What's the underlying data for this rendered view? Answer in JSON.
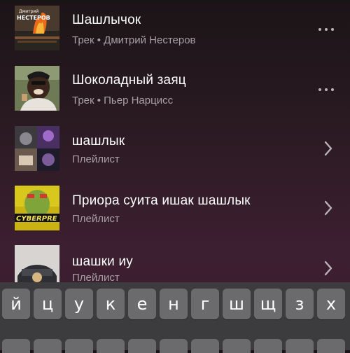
{
  "results": [
    {
      "title": "Шашлычок",
      "subtitle": "Трек • Дмитрий Нестеров",
      "action": "more-options",
      "thumb": "track-cover-1"
    },
    {
      "title": "Шоколадный заяц",
      "subtitle": "Трек • Пьер Нарцисс",
      "action": "more-options",
      "thumb": "track-cover-2"
    },
    {
      "title": "шашлык",
      "subtitle": "Плейлист",
      "action": "open",
      "thumb": "playlist-collage"
    },
    {
      "title": "Приора суита ишак шашлык",
      "subtitle": "Плейлист",
      "action": "open",
      "thumb": "playlist-cover"
    },
    {
      "title": "шашки иу",
      "subtitle": "Плейлист",
      "action": "open",
      "thumb": "playlist-cover-car"
    }
  ],
  "keyboard": {
    "row1": [
      "й",
      "ц",
      "у",
      "к",
      "е",
      "н",
      "г",
      "ш",
      "щ",
      "з",
      "х"
    ]
  },
  "cover_text": {
    "cover1_top": "Дмитрий",
    "cover1_name": "НЕСТЕРОВ",
    "cover4_text": "CYBERPRE"
  }
}
